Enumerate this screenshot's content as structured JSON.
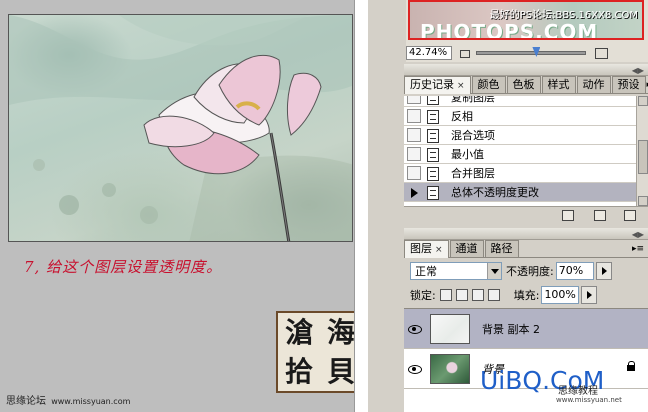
{
  "navigator": {
    "watermark_top": "最好的PS论坛:BBS.16XX8.COM",
    "watermark_logo": "PHOTOPS.COM",
    "zoom": "42.74%",
    "zoom_fraction": 0.55
  },
  "history": {
    "tabs": [
      {
        "label": "历史记录",
        "active": true
      },
      {
        "label": "颜色",
        "active": false
      },
      {
        "label": "色板",
        "active": false
      },
      {
        "label": "样式",
        "active": false
      },
      {
        "label": "动作",
        "active": false
      },
      {
        "label": "预设",
        "active": false
      }
    ],
    "items": [
      {
        "label": "复制图层",
        "current": false
      },
      {
        "label": "反相",
        "current": false
      },
      {
        "label": "混合选项",
        "current": false
      },
      {
        "label": "最小值",
        "current": false
      },
      {
        "label": "合并图层",
        "current": false
      },
      {
        "label": "总体不透明度更改",
        "current": true
      }
    ]
  },
  "layers": {
    "tabs": [
      {
        "label": "图层",
        "active": true
      },
      {
        "label": "通道",
        "active": false
      },
      {
        "label": "路径",
        "active": false
      }
    ],
    "blend_mode": "正常",
    "opacity_label": "不透明度:",
    "opacity_value": "70%",
    "lock_label": "锁定:",
    "fill_label": "填充:",
    "fill_value": "100%",
    "list": [
      {
        "name": "背景 副本 2",
        "selected": true,
        "thumb": "sketch",
        "locked": false
      },
      {
        "name": "背景",
        "selected": false,
        "thumb": "photo",
        "locked": true
      }
    ]
  },
  "tutorial": {
    "caption": "7, 给这个图层设置透明度。",
    "seal_chars": [
      "滄",
      "海",
      "拾",
      "貝"
    ],
    "footer_site": "思缘论坛",
    "footer_url": "www.missyuan.com"
  },
  "watermark": {
    "brand": "UiBQ.CoM",
    "sub": "思缘教程",
    "url": "www.missyuan.net"
  },
  "colors": {
    "caption_red": "#c8102e",
    "brand_blue": "#1f5fc8",
    "selection": "#b2b3c4"
  }
}
